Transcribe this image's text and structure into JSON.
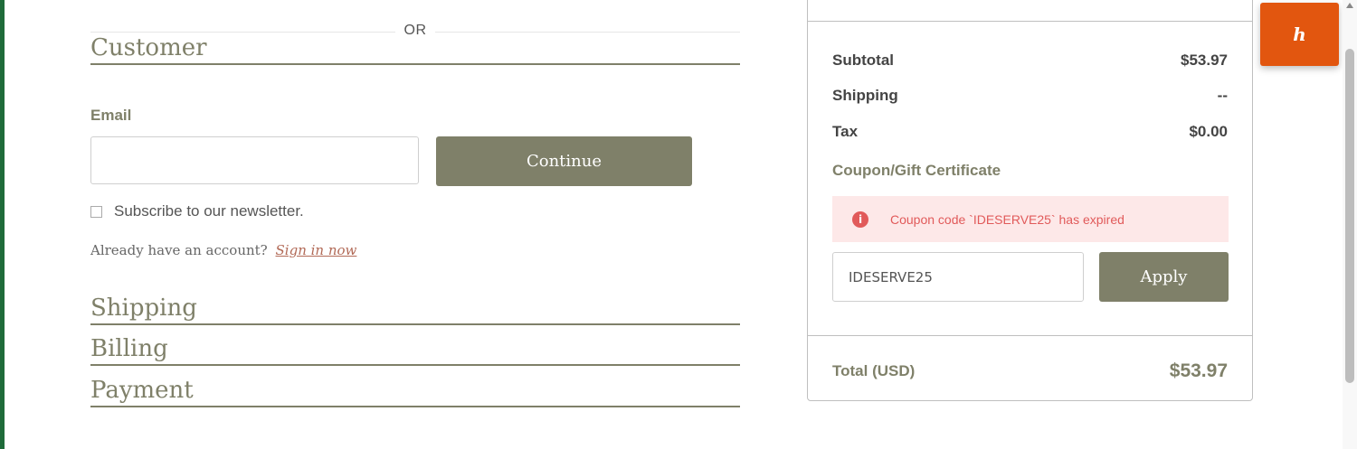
{
  "checkout": {
    "or_text": "OR",
    "customer_title": "Customer",
    "email_label": "Email",
    "email_value": "",
    "continue_label": "Continue",
    "newsletter_label": "Subscribe to our newsletter.",
    "account_prompt": "Already have an account?",
    "signin_link": "Sign in now",
    "shipping_title": "Shipping",
    "billing_title": "Billing",
    "payment_title": "Payment"
  },
  "summary": {
    "subtotal_label": "Subtotal",
    "subtotal_value": "$53.97",
    "shipping_label": "Shipping",
    "shipping_value": "--",
    "tax_label": "Tax",
    "tax_value": "$0.00",
    "coupon_heading": "Coupon/Gift Certificate",
    "alert_icon": "i",
    "alert_message": "Coupon code `IDESERVE25` has expired",
    "coupon_value": "IDESERVE25",
    "apply_label": "Apply",
    "total_label": "Total (USD)",
    "total_value": "$53.97"
  },
  "widget": {
    "icon": "honey-extension-icon",
    "glyph": "h"
  },
  "colors": {
    "accent": "#7f8069",
    "alert_bg": "#fde8e8",
    "alert_text": "#e15a5a",
    "widget": "#e2560f",
    "signin": "#b26a57"
  }
}
